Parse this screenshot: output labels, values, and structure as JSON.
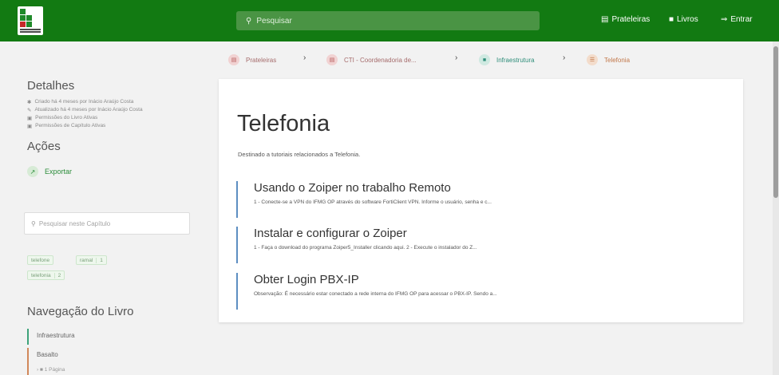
{
  "header": {
    "search_placeholder": "Pesquisar",
    "nav": [
      {
        "label": "Prateleiras",
        "icon": "shelves-icon"
      },
      {
        "label": "Livros",
        "icon": "book-icon"
      },
      {
        "label": "Entrar",
        "icon": "login-icon"
      }
    ]
  },
  "sidebar": {
    "details_title": "Detalhes",
    "details": [
      "Criado há 4 meses por Inácio Araújo Costa",
      "Atualizado há 4 meses por Inácio Araújo Costa",
      "Permissões do Livro Ativas",
      "Permissões de Capítulo Ativas"
    ],
    "actions_title": "Ações",
    "export_label": "Exportar",
    "chapter_search_placeholder": "Pesquisar neste Capítulo",
    "tags": [
      {
        "name": "telefone",
        "count": ""
      },
      {
        "name": "ramal",
        "count": "1"
      },
      {
        "name": "telefonia",
        "count": "2"
      }
    ],
    "book_nav_title": "Navegação do Livro",
    "book_nav": [
      {
        "label": "Infraestrutura"
      },
      {
        "label": "Basalto"
      },
      {
        "label": "1 Página"
      }
    ]
  },
  "breadcrumb": [
    {
      "label": "Prateleiras"
    },
    {
      "label": "CTI - Coordenadoria de..."
    },
    {
      "label": "Infraestrutura"
    },
    {
      "label": "Telefonia"
    }
  ],
  "page": {
    "title": "Telefonia",
    "description": "Destinado a tutoriais relacionados a Telefonia.",
    "entries": [
      {
        "title": "Usando o Zoiper no trabalho Remoto",
        "excerpt": "1 - Conecte-se a VPN do IFMG OP através do software FortiClient VPN. Informe o usuário, senha e c..."
      },
      {
        "title": "Instalar e configurar o Zoiper",
        "excerpt": "1 - Faça o download do programa Zoiper5_Installer clicando aqui. 2 - Execute o instalador do Z..."
      },
      {
        "title": "Obter Login PBX-IP",
        "excerpt": "Observação: É necessário estar conectado a rede interna do IFMG OP para acessar o PBX-IP. Sendo a..."
      }
    ]
  },
  "colors": {
    "header_green": "#127a12",
    "accent_green": "#2c8d3b",
    "entry_border": "#5d8ec2"
  }
}
